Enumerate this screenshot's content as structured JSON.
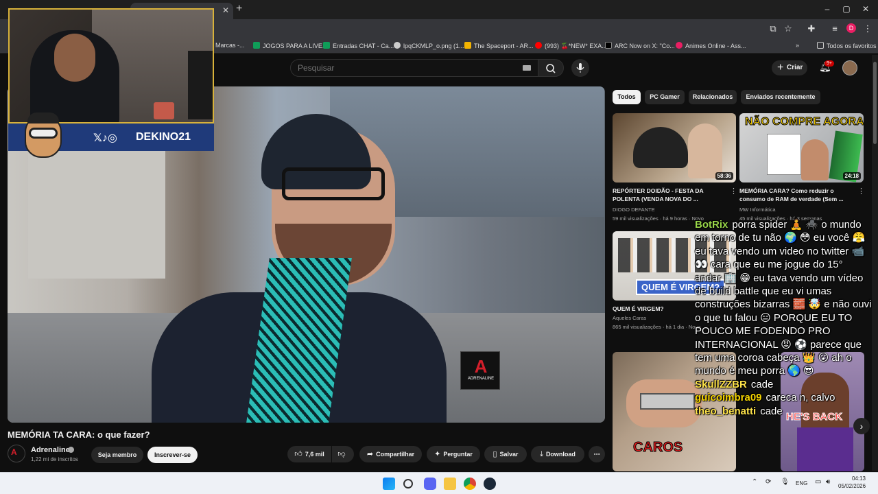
{
  "browser": {
    "active_tab": "",
    "bookmarks": [
      {
        "label": "Marcas -...",
        "color": "#888888"
      },
      {
        "label": "JOGOS PARA A LIVE...",
        "color": "#0f9d58"
      },
      {
        "label": "Entradas CHAT - Ca...",
        "color": "#0f9d58"
      },
      {
        "label": "lpqCKMLP_o.png (1...",
        "color": "#cccccc"
      },
      {
        "label": "The Spaceport - AR...",
        "color": "#f4b400"
      },
      {
        "label": "(993) 🍒*NEW* EXA...",
        "color": "#ff0000"
      },
      {
        "label": "ARC Now on X: \"Co...",
        "color": "#000000"
      },
      {
        "label": "Animes Online - Ass...",
        "color": "#e91e63"
      }
    ],
    "other_bookmarks": "Todos os favoritos",
    "profile_initial": "D"
  },
  "header": {
    "search_placeholder": "Pesquisar",
    "create_label": "Criar",
    "notif_count": "9+"
  },
  "overlay": {
    "social_handle": "DEKINO21"
  },
  "video": {
    "title": "MEMÓRIA TA CARA: o que fazer?",
    "channel": "Adrenaline",
    "subscribers": "1,22 mi de inscritos",
    "join_label": "Seja membro",
    "subscribe_label": "Inscrever-se",
    "likes": "7,6 mil",
    "share_label": "Compartilhar",
    "ask_label": "Perguntar",
    "save_label": "Salvar",
    "download_label": "Download",
    "logo_text": "ADRENALINE"
  },
  "sidebar": {
    "chips": [
      "Todos",
      "PC Gamer",
      "Relacionados",
      "Enviados recentemente"
    ],
    "videos": [
      {
        "title": "REPÓRTER DOIDÃO - FESTA DA POLENTA (VENDA NOVA DO ...",
        "channel": "DIOGO DEFANTE",
        "meta": "59 mil visualizações · há 9 horas · Novo",
        "duration": "58:36"
      },
      {
        "title": "MEMÓRIA CARA? Como reduzir o consumo de RAM de verdade (Sem ...",
        "channel": "MW Informática",
        "meta": "45 mil visualizações · há 3 semanas",
        "duration": "24:18",
        "thumb_text": "NÃO COMPRE AGORA"
      },
      {
        "title": "QUEM É VIRGEM?",
        "channel": "Aqueles Caras",
        "meta": "865 mil visualizações · há 1 dia · Novo",
        "thumb_text": "QUEM É VIRGEM?"
      },
      {
        "thumb_text": "CAROS"
      },
      {
        "thumb_text": "HE'S BACK"
      }
    ]
  },
  "chat": [
    {
      "user": "BotRix",
      "color": "#9ad84a",
      "text": "porra spider 🧘 🕷️ o mundo em torno de tu não 🌍 😳 eu você 😤 eu tava vendo um video no twitter 📹 👀 cara que eu me jogue do 15° andar 🏢 😁 eu tava vendo um vídeo de build battle que eu vi umas construções bizarras 🧱 🤯 e não ouvi o que tu falou 😑 PORQUE EU TO POUCO ME FODENDO PRO INTERNACIONAL 😡 ⚽ parece que tem uma coroa cabeça 👑 😮 ah o mundo é meu porra 🌎 😎"
    },
    {
      "user": "SkullZZBR",
      "color": "#ffe44a",
      "text": "cade"
    },
    {
      "user": "guicoimbra09",
      "color": "#f5d400",
      "text": "careca n, calvo"
    },
    {
      "user": "theo_benatti",
      "color": "#ffe44a",
      "text": "cade"
    }
  ],
  "taskbar": {
    "lang": "ENG",
    "time": "04:13",
    "date": "05/02/2026"
  }
}
